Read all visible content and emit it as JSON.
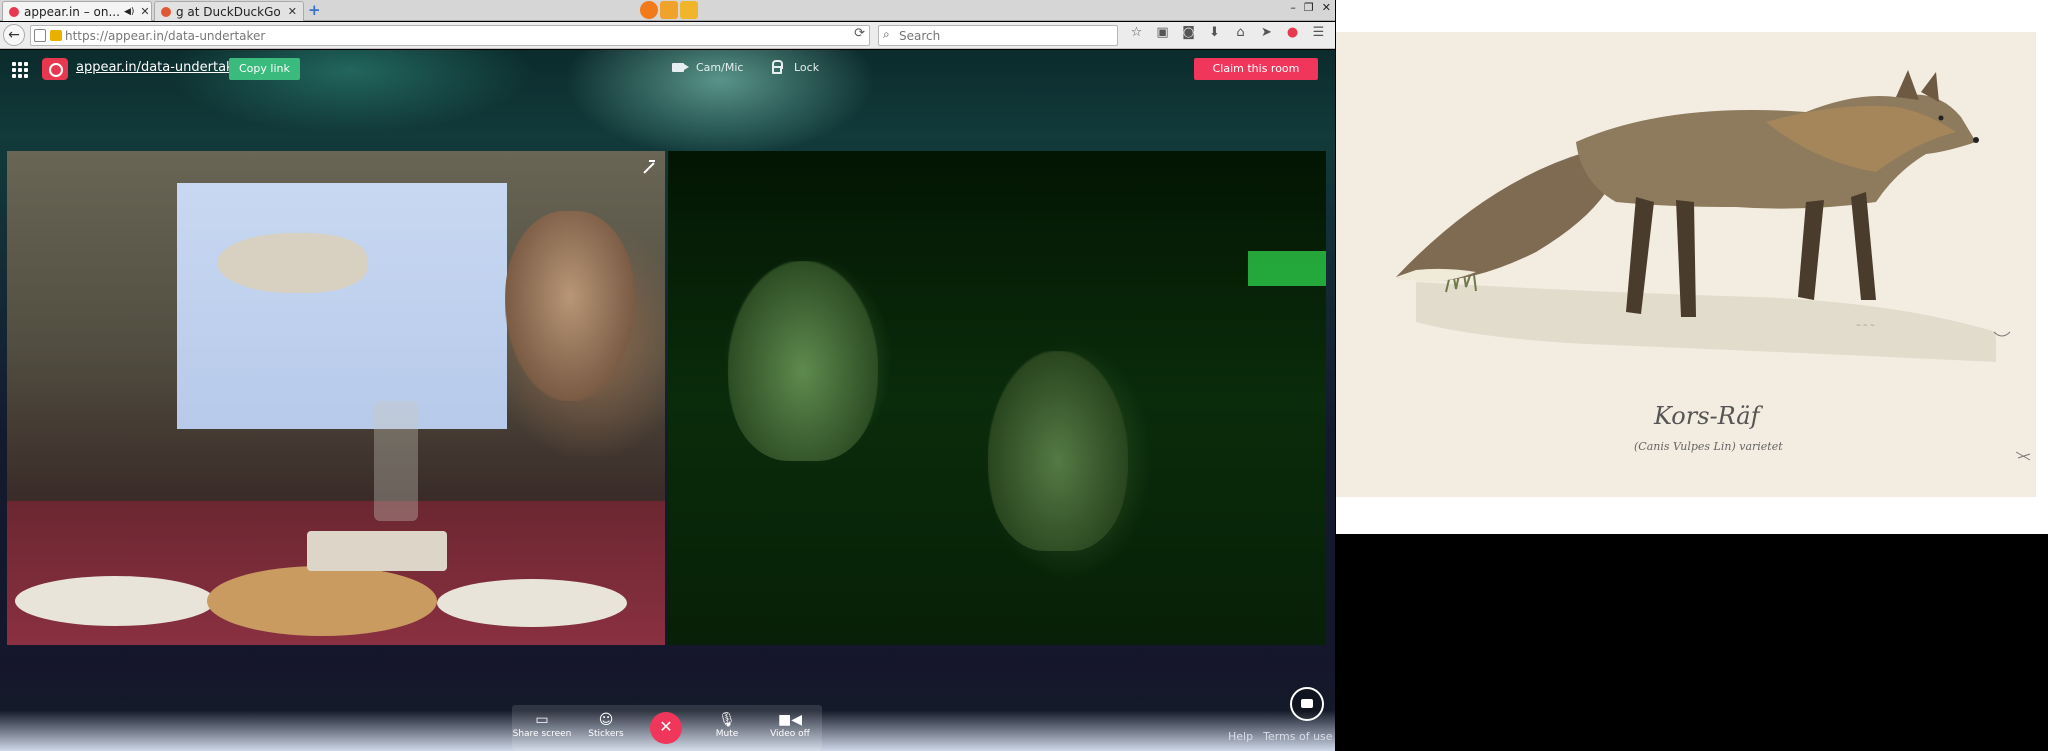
{
  "browser": {
    "tabs": [
      {
        "label": "appear.in – on...",
        "active": true
      },
      {
        "label": "g at DuckDuckGo",
        "active": false
      }
    ],
    "new_tab": "+",
    "url": "https://appear.in/data-undertaker",
    "search_placeholder": "Search"
  },
  "room": {
    "link_text": "appear.in/data-undertaker",
    "copy_label": "Copy link",
    "cam_mic_label": "Cam/Mic",
    "lock_label": "Lock",
    "claim_label": "Claim this room"
  },
  "controls": {
    "share_label": "Share screen",
    "stickers_label": "Stickers",
    "hangup_glyph": "✕",
    "mute_label": "Mute",
    "video_label": "Video off"
  },
  "footer": {
    "help": "Help",
    "terms": "Terms of use"
  },
  "illustration": {
    "caption_title": "Kors-Räf",
    "caption_sub": "(Canis Vulpes Lin) varietet"
  },
  "colors": {
    "accent_pink": "#f0365a",
    "copy_green": "#3aba7c",
    "logo_red": "#e8384f"
  },
  "icons": [
    "menu-grid-icon",
    "camera-icon",
    "lock-icon",
    "expand-icon",
    "screen-icon",
    "smiley-icon",
    "close-icon",
    "microphone-icon",
    "video-camera-icon",
    "chat-icon"
  ]
}
